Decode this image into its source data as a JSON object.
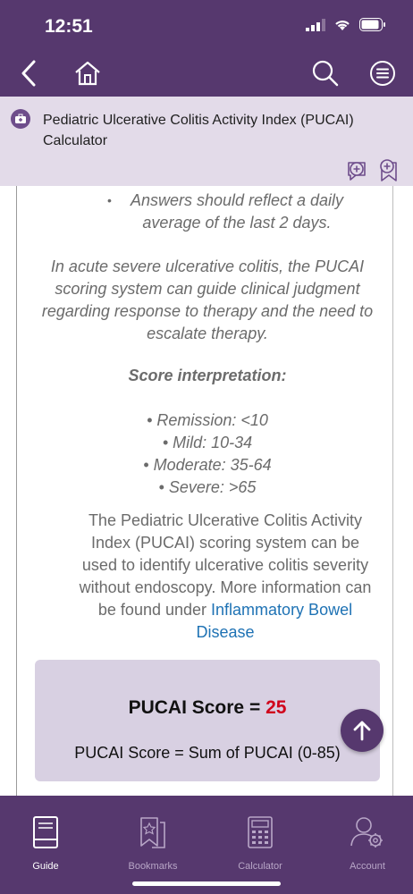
{
  "status": {
    "time": "12:51"
  },
  "title": {
    "text": "Pediatric Ulcerative Colitis Activity Index (PUCAI) Calculator"
  },
  "content": {
    "partial_bullet": "Answers should reflect a daily average of the last 2 days.",
    "note": "In acute severe ulcerative colitis, the PUCAI scoring system can guide clinical judgment regarding response to therapy and the need to escalate therapy.",
    "interpretation_heading": "Score interpretation:",
    "interpretation": [
      "Remission: <10",
      "Mild: 10-34",
      "Moderate: 35-64",
      "Severe: >65"
    ],
    "description": "The Pediatric Ulcerative Colitis Activity Index (PUCAI) scoring system can be used to identify ulcerative colitis severity without endoscopy. More information can be found under",
    "link_text": "Inflammatory Bowel Disease"
  },
  "result": {
    "label": "PUCAI Score = ",
    "value": "25",
    "formula": "PUCAI Score = Sum of PUCAI (0-85)"
  },
  "tabs": [
    {
      "label": "Guide",
      "icon": "guide-book-icon"
    },
    {
      "label": "Bookmarks",
      "icon": "bookmarks-icon"
    },
    {
      "label": "Calculator",
      "icon": "calculator-icon"
    },
    {
      "label": "Account",
      "icon": "account-icon"
    }
  ],
  "colors": {
    "brand": "#56386e",
    "banner": "#e3dbe9",
    "score_value": "#d0021b",
    "link": "#1e72b4"
  }
}
